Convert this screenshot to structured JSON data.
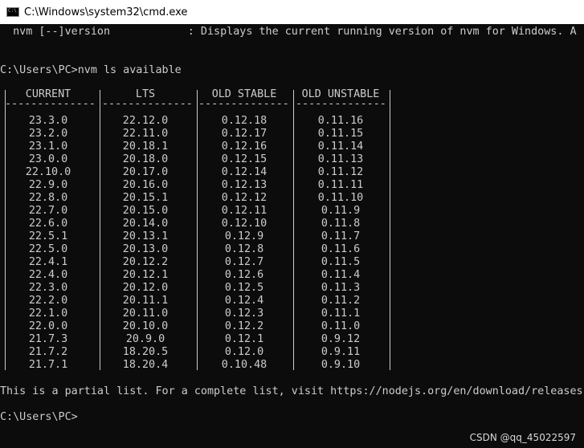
{
  "window": {
    "title": "C:\\Windows\\system32\\cmd.exe",
    "icon": "cmd-icon",
    "icon_text": "C:\\"
  },
  "console": {
    "line1": "  nvm [--]version            : Displays the current running version of nvm for Windows. A",
    "prompt1": "C:\\Users\\PC>nvm ls available",
    "partial_note": "This is a partial list. For a complete list, visit https://nodejs.org/en/download/releases",
    "prompt2": "C:\\Users\\PC>"
  },
  "table": {
    "headers": [
      "CURRENT",
      "LTS",
      "OLD STABLE",
      "OLD UNSTABLE"
    ],
    "dash": "--------------",
    "rows": [
      [
        "23.3.0",
        "22.12.0",
        "0.12.18",
        "0.11.16"
      ],
      [
        "23.2.0",
        "22.11.0",
        "0.12.17",
        "0.11.15"
      ],
      [
        "23.1.0",
        "20.18.1",
        "0.12.16",
        "0.11.14"
      ],
      [
        "23.0.0",
        "20.18.0",
        "0.12.15",
        "0.11.13"
      ],
      [
        "22.10.0",
        "20.17.0",
        "0.12.14",
        "0.11.12"
      ],
      [
        "22.9.0",
        "20.16.0",
        "0.12.13",
        "0.11.11"
      ],
      [
        "22.8.0",
        "20.15.1",
        "0.12.12",
        "0.11.10"
      ],
      [
        "22.7.0",
        "20.15.0",
        "0.12.11",
        "0.11.9"
      ],
      [
        "22.6.0",
        "20.14.0",
        "0.12.10",
        "0.11.8"
      ],
      [
        "22.5.1",
        "20.13.1",
        "0.12.9",
        "0.11.7"
      ],
      [
        "22.5.0",
        "20.13.0",
        "0.12.8",
        "0.11.6"
      ],
      [
        "22.4.1",
        "20.12.2",
        "0.12.7",
        "0.11.5"
      ],
      [
        "22.4.0",
        "20.12.1",
        "0.12.6",
        "0.11.4"
      ],
      [
        "22.3.0",
        "20.12.0",
        "0.12.5",
        "0.11.3"
      ],
      [
        "22.2.0",
        "20.11.1",
        "0.12.4",
        "0.11.2"
      ],
      [
        "22.1.0",
        "20.11.0",
        "0.12.3",
        "0.11.1"
      ],
      [
        "22.0.0",
        "20.10.0",
        "0.12.2",
        "0.11.0"
      ],
      [
        "21.7.3",
        "20.9.0",
        "0.12.1",
        "0.9.12"
      ],
      [
        "21.7.2",
        "18.20.5",
        "0.12.0",
        "0.9.11"
      ],
      [
        "21.7.1",
        "18.20.4",
        "0.10.48",
        "0.9.10"
      ]
    ]
  },
  "watermark": "CSDN @qq_45022597",
  "colors": {
    "background": "#0c0c0c",
    "foreground": "#cccccc",
    "titlebar": "#ffffff"
  }
}
